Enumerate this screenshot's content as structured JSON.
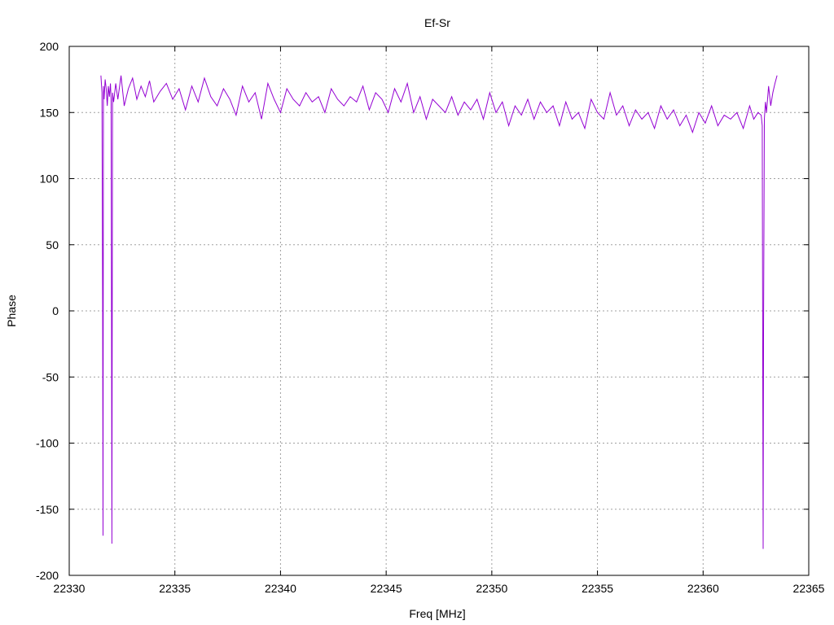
{
  "chart_data": {
    "type": "line",
    "title": "Ef-Sr",
    "xlabel": "Freq [MHz]",
    "ylabel": "Phase",
    "xlim": [
      22330,
      22365
    ],
    "ylim": [
      -200,
      200
    ],
    "xticks": [
      22330,
      22335,
      22340,
      22345,
      22350,
      22355,
      22360,
      22365
    ],
    "yticks": [
      -200,
      -150,
      -100,
      -50,
      0,
      50,
      100,
      150,
      200
    ],
    "grid": true,
    "series_color": "#9400d3",
    "series": [
      {
        "x": [
          22331.5,
          22331.55,
          22331.58,
          22331.6,
          22331.62,
          22331.65,
          22331.7,
          22331.75,
          22331.8,
          22331.85,
          22331.9,
          22331.95,
          22331.98,
          22332.0,
          22332.02,
          22332.05,
          22332.1,
          22332.2,
          22332.3,
          22332.45,
          22332.6,
          22332.8,
          22333.0,
          22333.2,
          22333.4,
          22333.6,
          22333.8,
          22334.0,
          22334.3,
          22334.6,
          22334.9,
          22335.2,
          22335.5,
          22335.8,
          22336.1,
          22336.4,
          22336.7,
          22337.0,
          22337.3,
          22337.6,
          22337.9,
          22338.2,
          22338.5,
          22338.8,
          22339.1,
          22339.4,
          22339.7,
          22340.0,
          22340.3,
          22340.6,
          22340.9,
          22341.2,
          22341.5,
          22341.8,
          22342.1,
          22342.4,
          22342.7,
          22343.0,
          22343.3,
          22343.6,
          22343.9,
          22344.2,
          22344.5,
          22344.8,
          22345.1,
          22345.4,
          22345.7,
          22346.0,
          22346.3,
          22346.6,
          22346.9,
          22347.2,
          22347.5,
          22347.8,
          22348.1,
          22348.4,
          22348.7,
          22349.0,
          22349.3,
          22349.6,
          22349.9,
          22350.2,
          22350.5,
          22350.8,
          22351.1,
          22351.4,
          22351.7,
          22352.0,
          22352.3,
          22352.6,
          22352.9,
          22353.2,
          22353.5,
          22353.8,
          22354.1,
          22354.4,
          22354.7,
          22355.0,
          22355.3,
          22355.6,
          22355.9,
          22356.2,
          22356.5,
          22356.8,
          22357.1,
          22357.4,
          22357.7,
          22358.0,
          22358.3,
          22358.6,
          22358.9,
          22359.2,
          22359.5,
          22359.8,
          22360.1,
          22360.4,
          22360.7,
          22361.0,
          22361.3,
          22361.6,
          22361.9,
          22362.2,
          22362.4,
          22362.6,
          22362.75,
          22362.8,
          22362.82,
          22362.84,
          22362.86,
          22362.9,
          22362.95,
          22363.0,
          22363.1,
          22363.2,
          22363.3,
          22363.4,
          22363.5
        ],
        "y": [
          178,
          165,
          5,
          -170,
          170,
          160,
          175,
          168,
          155,
          170,
          162,
          172,
          160,
          0,
          -176,
          165,
          158,
          172,
          160,
          178,
          155,
          168,
          176,
          160,
          170,
          162,
          174,
          158,
          166,
          172,
          160,
          168,
          152,
          170,
          158,
          176,
          162,
          155,
          168,
          160,
          148,
          170,
          158,
          165,
          145,
          172,
          160,
          150,
          168,
          160,
          155,
          165,
          158,
          162,
          150,
          168,
          160,
          155,
          162,
          158,
          170,
          152,
          165,
          160,
          150,
          168,
          158,
          172,
          150,
          162,
          145,
          160,
          155,
          150,
          162,
          148,
          158,
          152,
          160,
          145,
          165,
          150,
          158,
          140,
          155,
          148,
          160,
          145,
          158,
          150,
          155,
          140,
          158,
          145,
          150,
          138,
          160,
          150,
          145,
          165,
          148,
          155,
          140,
          152,
          145,
          150,
          138,
          155,
          145,
          152,
          140,
          148,
          135,
          150,
          142,
          155,
          140,
          148,
          145,
          150,
          138,
          155,
          145,
          150,
          148,
          140,
          -10,
          -180,
          -15,
          145,
          158,
          150,
          170,
          155,
          165,
          172,
          178
        ]
      }
    ]
  }
}
